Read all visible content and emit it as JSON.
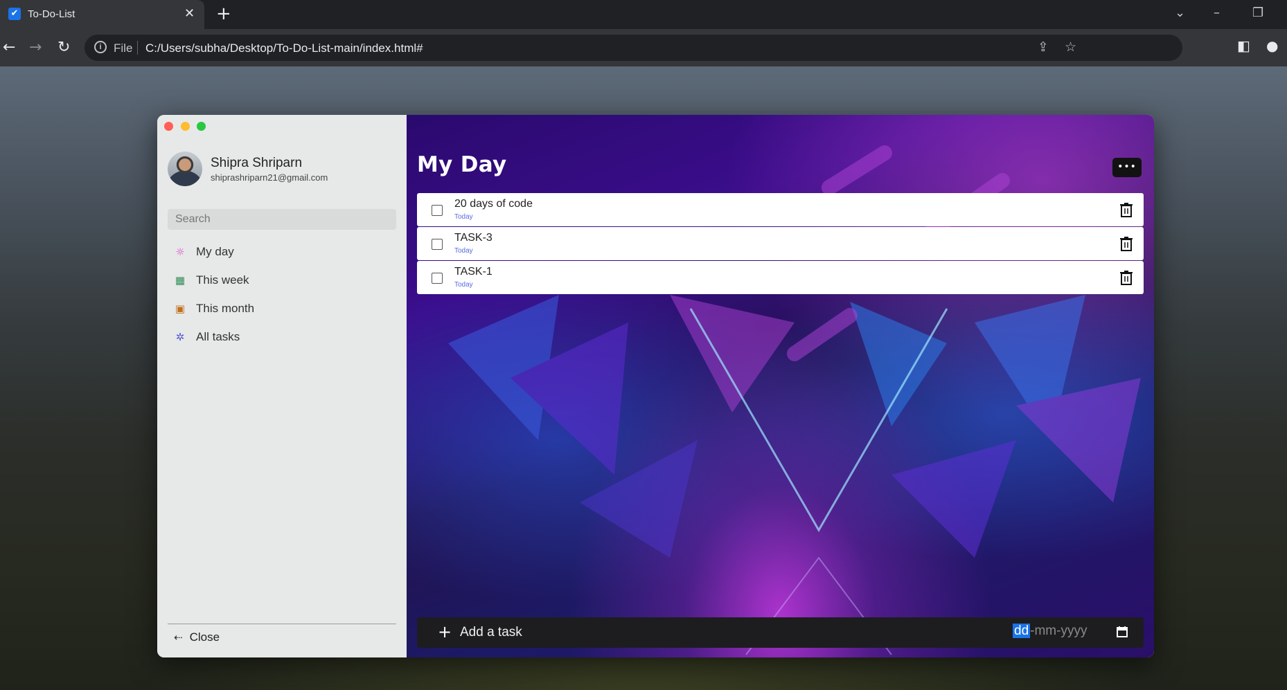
{
  "browser": {
    "tab_title": "To-Do-List",
    "favicon": "✔",
    "omnibox_scheme": "File",
    "url": "C:/Users/subha/Desktop/To-Do-List-main/index.html#"
  },
  "sidebar": {
    "user": {
      "name": "Shipra Shriparn",
      "email": "shiprashriparn21@gmail.com"
    },
    "search_placeholder": "Search",
    "items": [
      {
        "label": "My day",
        "icon": "sun-icon",
        "icon_color": "#d946c9"
      },
      {
        "label": "This week",
        "icon": "grid-icon",
        "icon_color": "#2e8b57"
      },
      {
        "label": "This month",
        "icon": "calendar-icon",
        "icon_color": "#c0701b"
      },
      {
        "label": "All tasks",
        "icon": "puzzle-icon",
        "icon_color": "#5b5bd6"
      }
    ],
    "close_label": "Close"
  },
  "main": {
    "title": "My Day",
    "tasks": [
      {
        "name": "20 days of code",
        "date": "Today"
      },
      {
        "name": "TASK-3",
        "date": "Today"
      },
      {
        "name": "TASK-1",
        "date": "Today"
      }
    ],
    "add_placeholder": "Add a task",
    "date_placeholder": {
      "dd": "dd",
      "rest": "-mm-yyyy"
    }
  },
  "colors": {
    "accent_blue": "#1a73e8",
    "task_date": "#5a6ae0"
  }
}
